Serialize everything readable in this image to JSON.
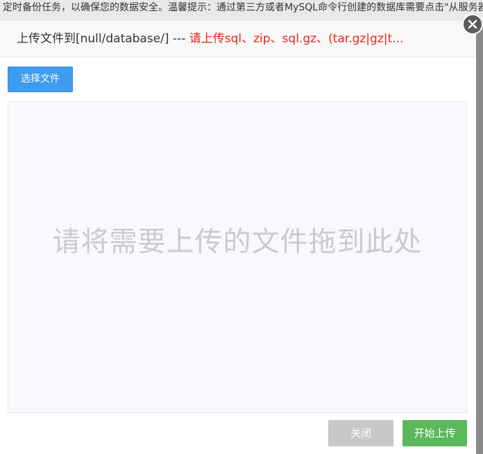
{
  "background": {
    "notice": "定时备份任务，以确保您的数据安全。温馨提示：通过第三方或者MySQL命令行创建的数据库需要点击\"从服务器获取\""
  },
  "modal": {
    "title_prefix": "上传文件到[null/database/] --- ",
    "title_hint": "请上传sql、zip、sql.gz、(tar.gz|gz|t...",
    "select_file_label": "选择文件",
    "drop_zone_text": "请将需要上传的文件拖到此处",
    "close_label": "关闭",
    "start_upload_label": "开始上传"
  },
  "colors": {
    "primary": "#3e9bf0",
    "success": "#5cb85c",
    "danger_text": "#e8251e",
    "disabled": "#c8c8c8"
  },
  "icons": {
    "close": "close-icon"
  }
}
